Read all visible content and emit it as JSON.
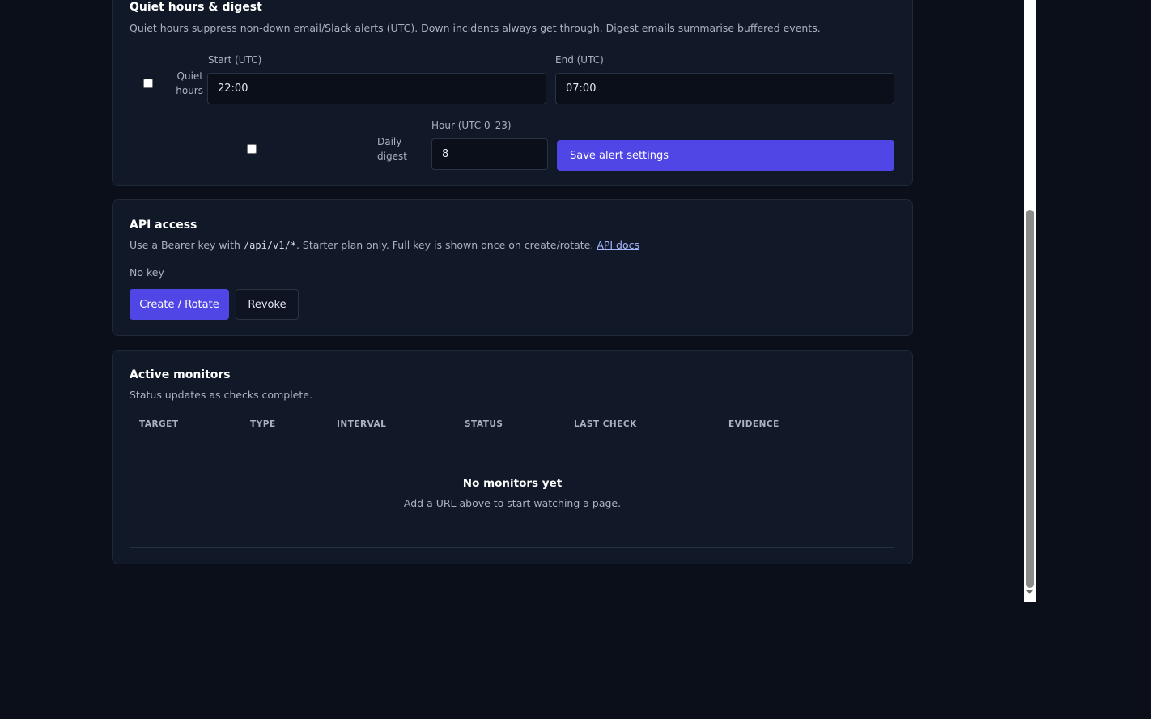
{
  "quiet": {
    "title": "Quiet hours & digest",
    "subtitle": "Quiet hours suppress non-down email/Slack alerts (UTC). Down incidents always get through. Digest emails summarise buffered events.",
    "quiet_label": "Quiet hours",
    "start_label": "Start (UTC)",
    "start_value": "22:00",
    "end_label": "End (UTC)",
    "end_value": "07:00",
    "digest_label": "Daily digest",
    "hour_label": "Hour (UTC 0–23)",
    "hour_value": "8",
    "save_label": "Save alert settings"
  },
  "api": {
    "title": "API access",
    "subtitle_prefix": "Use a Bearer key with ",
    "subtitle_code": "/api/v1/*",
    "subtitle_suffix": ". Starter plan only. Full key is shown once on create/rotate. ",
    "docs_link": "API docs",
    "key_status": "No key",
    "create_label": "Create / Rotate",
    "revoke_label": "Revoke"
  },
  "monitors": {
    "title": "Active monitors",
    "subtitle": "Status updates as checks complete.",
    "columns": [
      "TARGET",
      "TYPE",
      "INTERVAL",
      "STATUS",
      "LAST CHECK",
      "EVIDENCE"
    ],
    "empty_title": "No monitors yet",
    "empty_subtitle": "Add a URL above to start watching a page."
  },
  "colors": {
    "background": "#0b0f1a",
    "card": "#111827",
    "accent": "#4f46e5",
    "link": "#a5b4fc"
  }
}
